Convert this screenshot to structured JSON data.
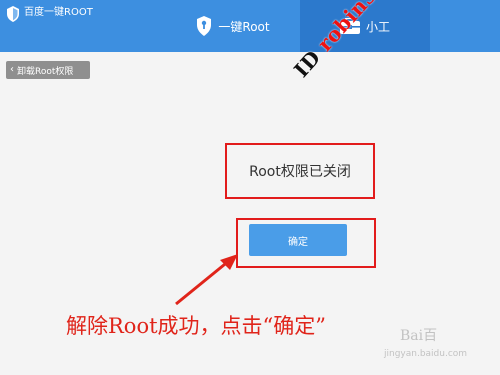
{
  "app": {
    "title": "百度一键ROOT"
  },
  "tabs": [
    {
      "label": "一键Root",
      "icon": "shield-key-icon",
      "active": false
    },
    {
      "label": "小工",
      "icon": "toolbox-icon",
      "active": true
    }
  ],
  "toolbar": {
    "back_label": "卸载Root权限",
    "back_icon": "chevron-left-icon"
  },
  "main": {
    "status_message": "Root权限已关闭",
    "confirm_label": "确定"
  },
  "annotation": {
    "text": "解除Root成功，点击“确定”",
    "color": "#e0241a"
  },
  "watermark": {
    "prefix": "ID",
    "name": "robin553",
    "brand": "Bai百",
    "url": "jingyan.baidu.com"
  },
  "colors": {
    "titlebar": "#3d8fe0",
    "active_tab": "#2c79cc",
    "button": "#4a9de8",
    "highlight": "#e21b1b"
  }
}
